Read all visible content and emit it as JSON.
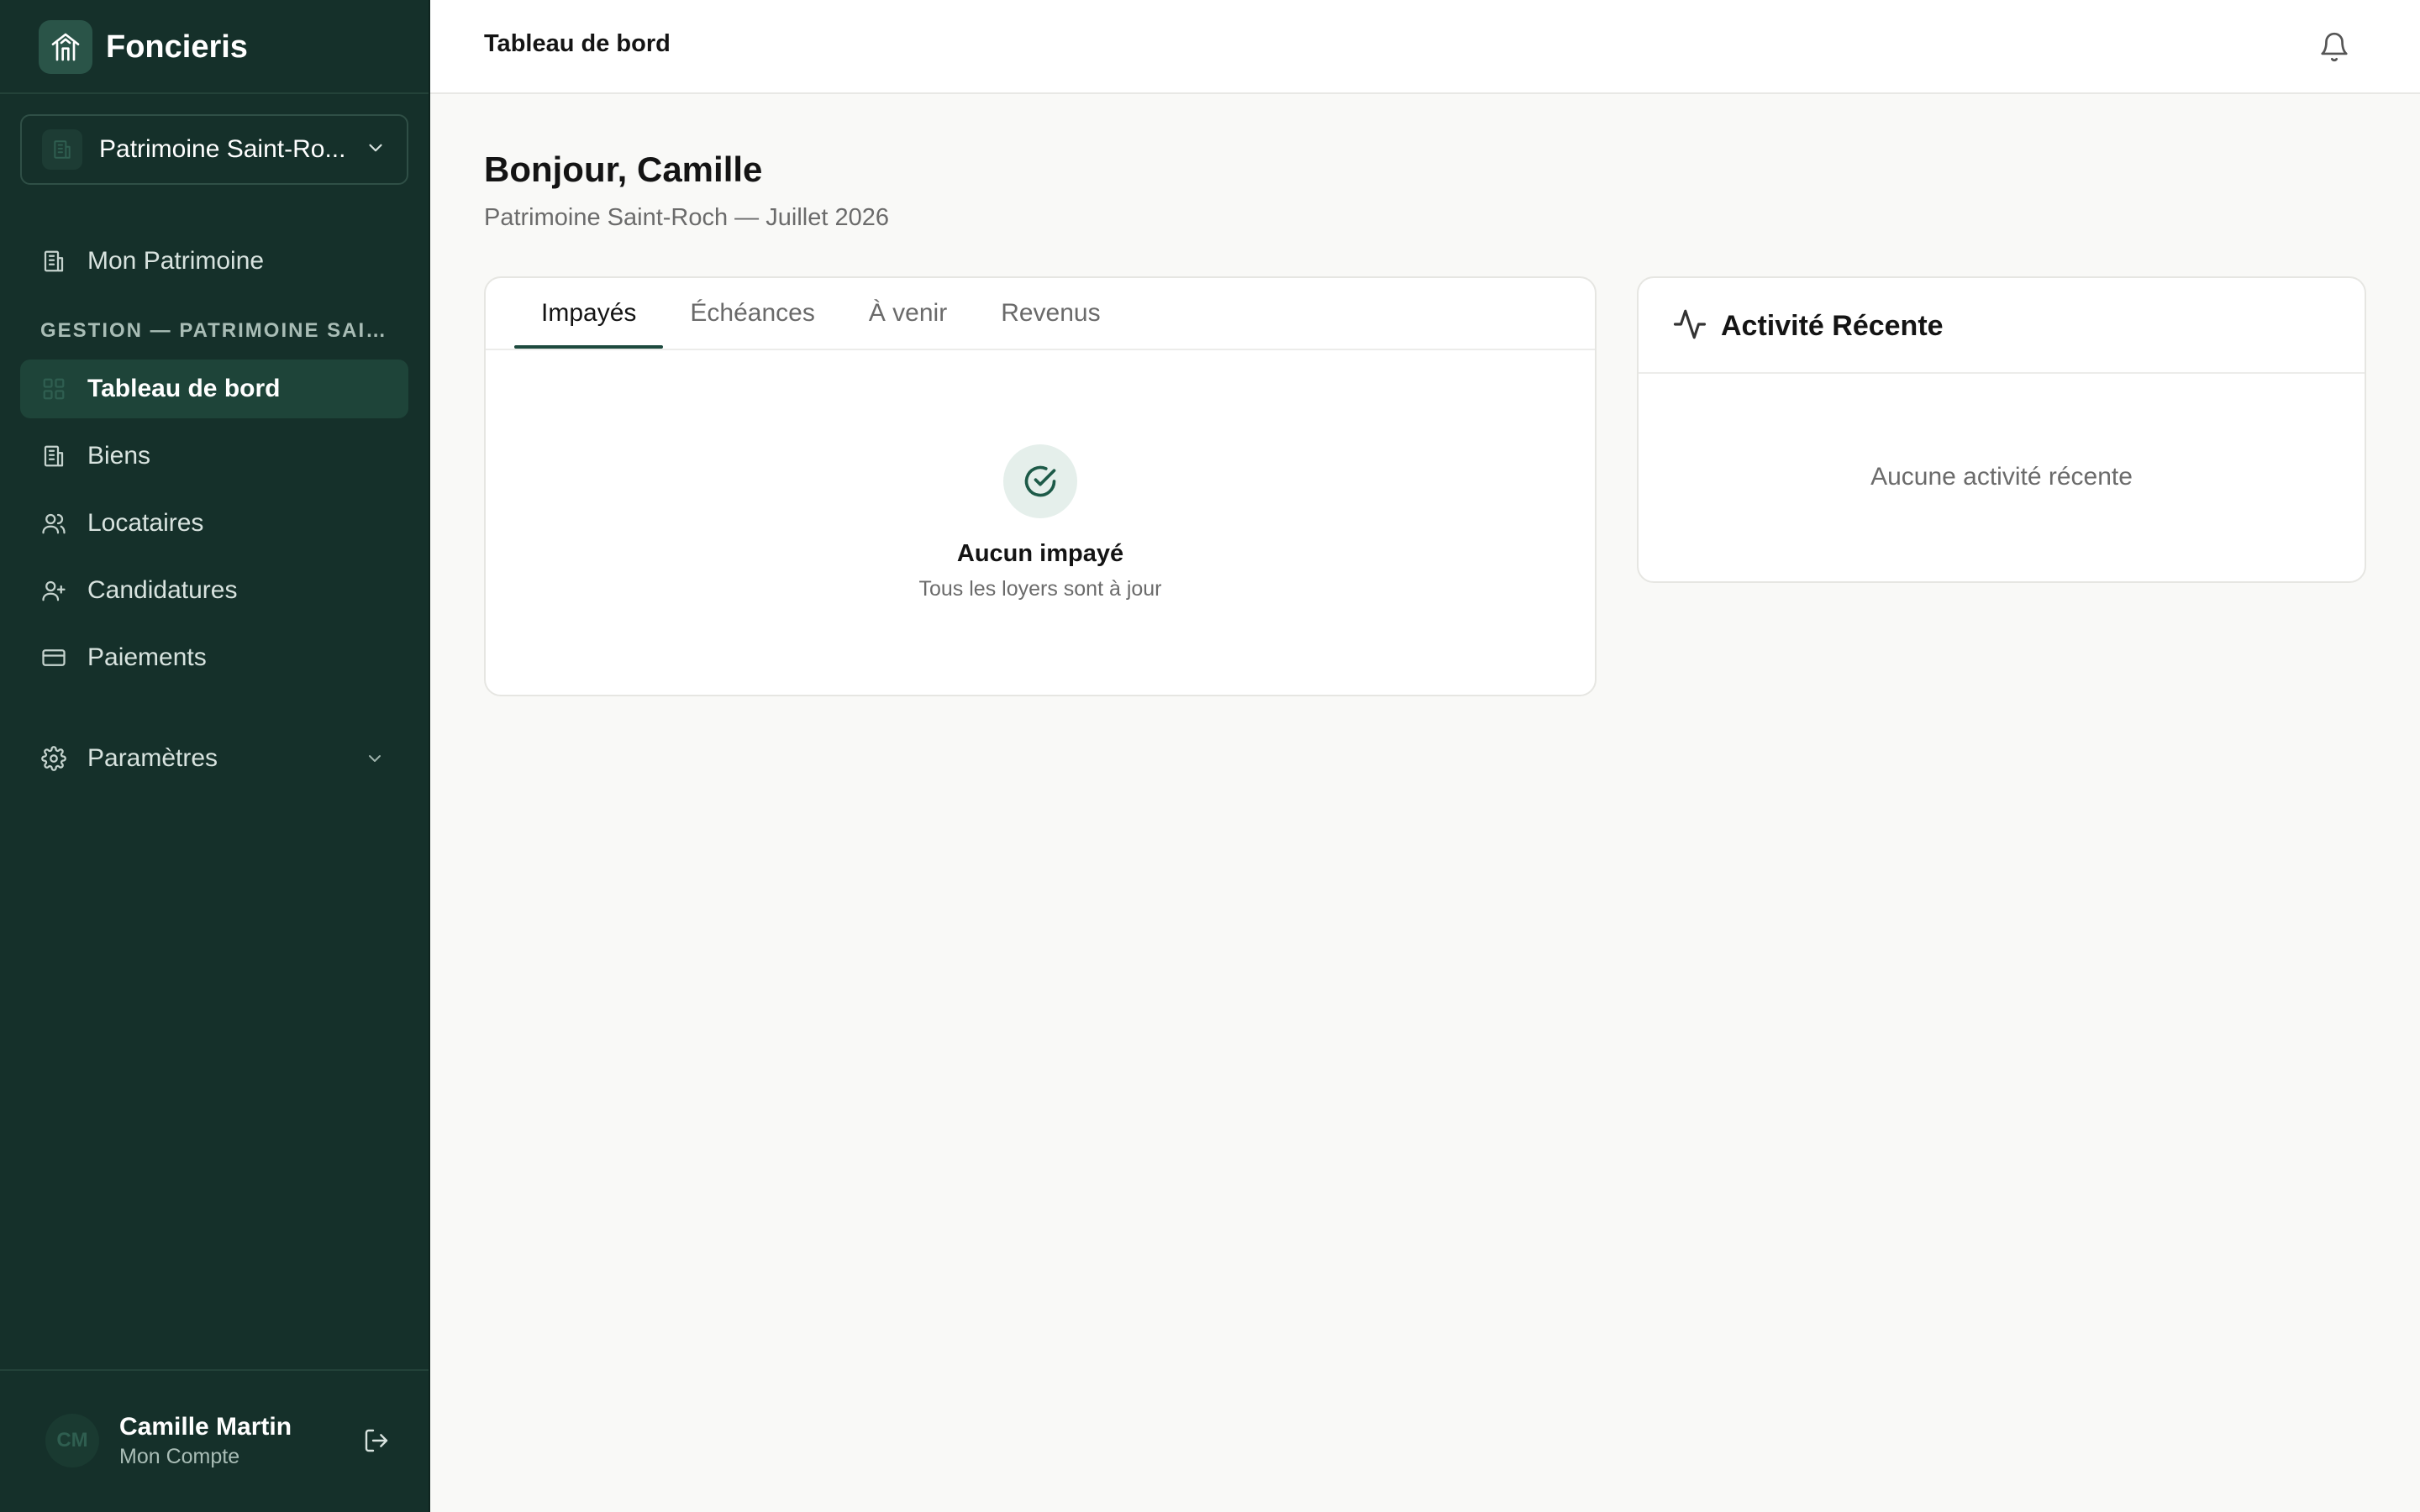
{
  "app": {
    "brand_name": "Foncieris",
    "logo_icon": "building-house-icon"
  },
  "sidebar": {
    "patrimoine_selector": {
      "label": "Patrimoine Saint-Ro...",
      "icon": "building-icon"
    },
    "items_top": [
      {
        "label": "Mon Patrimoine",
        "icon": "building-icon"
      }
    ],
    "section_label": "GESTION — PATRIMOINE SAIN...",
    "items": [
      {
        "label": "Tableau de bord",
        "icon": "dashboard-icon",
        "active": true
      },
      {
        "label": "Biens",
        "icon": "building-icon"
      },
      {
        "label": "Locataires",
        "icon": "users-icon"
      },
      {
        "label": "Candidatures",
        "icon": "user-plus-icon"
      },
      {
        "label": "Paiements",
        "icon": "credit-card-icon"
      }
    ],
    "settings": {
      "label": "Paramètres",
      "icon": "gear-icon"
    },
    "user": {
      "initials": "CM",
      "name": "Camille Martin",
      "subtitle": "Mon Compte"
    }
  },
  "header": {
    "title": "Tableau de bord",
    "notification_icon": "bell-icon"
  },
  "main": {
    "greeting": "Bonjour, Camille",
    "subtitle": "Patrimoine Saint-Roch — Juillet 2026",
    "tabs": [
      {
        "label": "Impayés",
        "active": true
      },
      {
        "label": "Échéances"
      },
      {
        "label": "À venir"
      },
      {
        "label": "Revenus"
      }
    ],
    "empty_state": {
      "title": "Aucun impayé",
      "subtitle": "Tous les loyers sont à jour",
      "icon": "check-circle-icon"
    },
    "activity": {
      "title": "Activité Récente",
      "icon": "activity-pulse-icon",
      "empty_text": "Aucune activité récente"
    }
  },
  "colors": {
    "sidebar_bg": "#15302a",
    "accent": "#1d4a3e",
    "active_nav_bg": "#1e4439",
    "page_bg": "#f9f9f7"
  }
}
